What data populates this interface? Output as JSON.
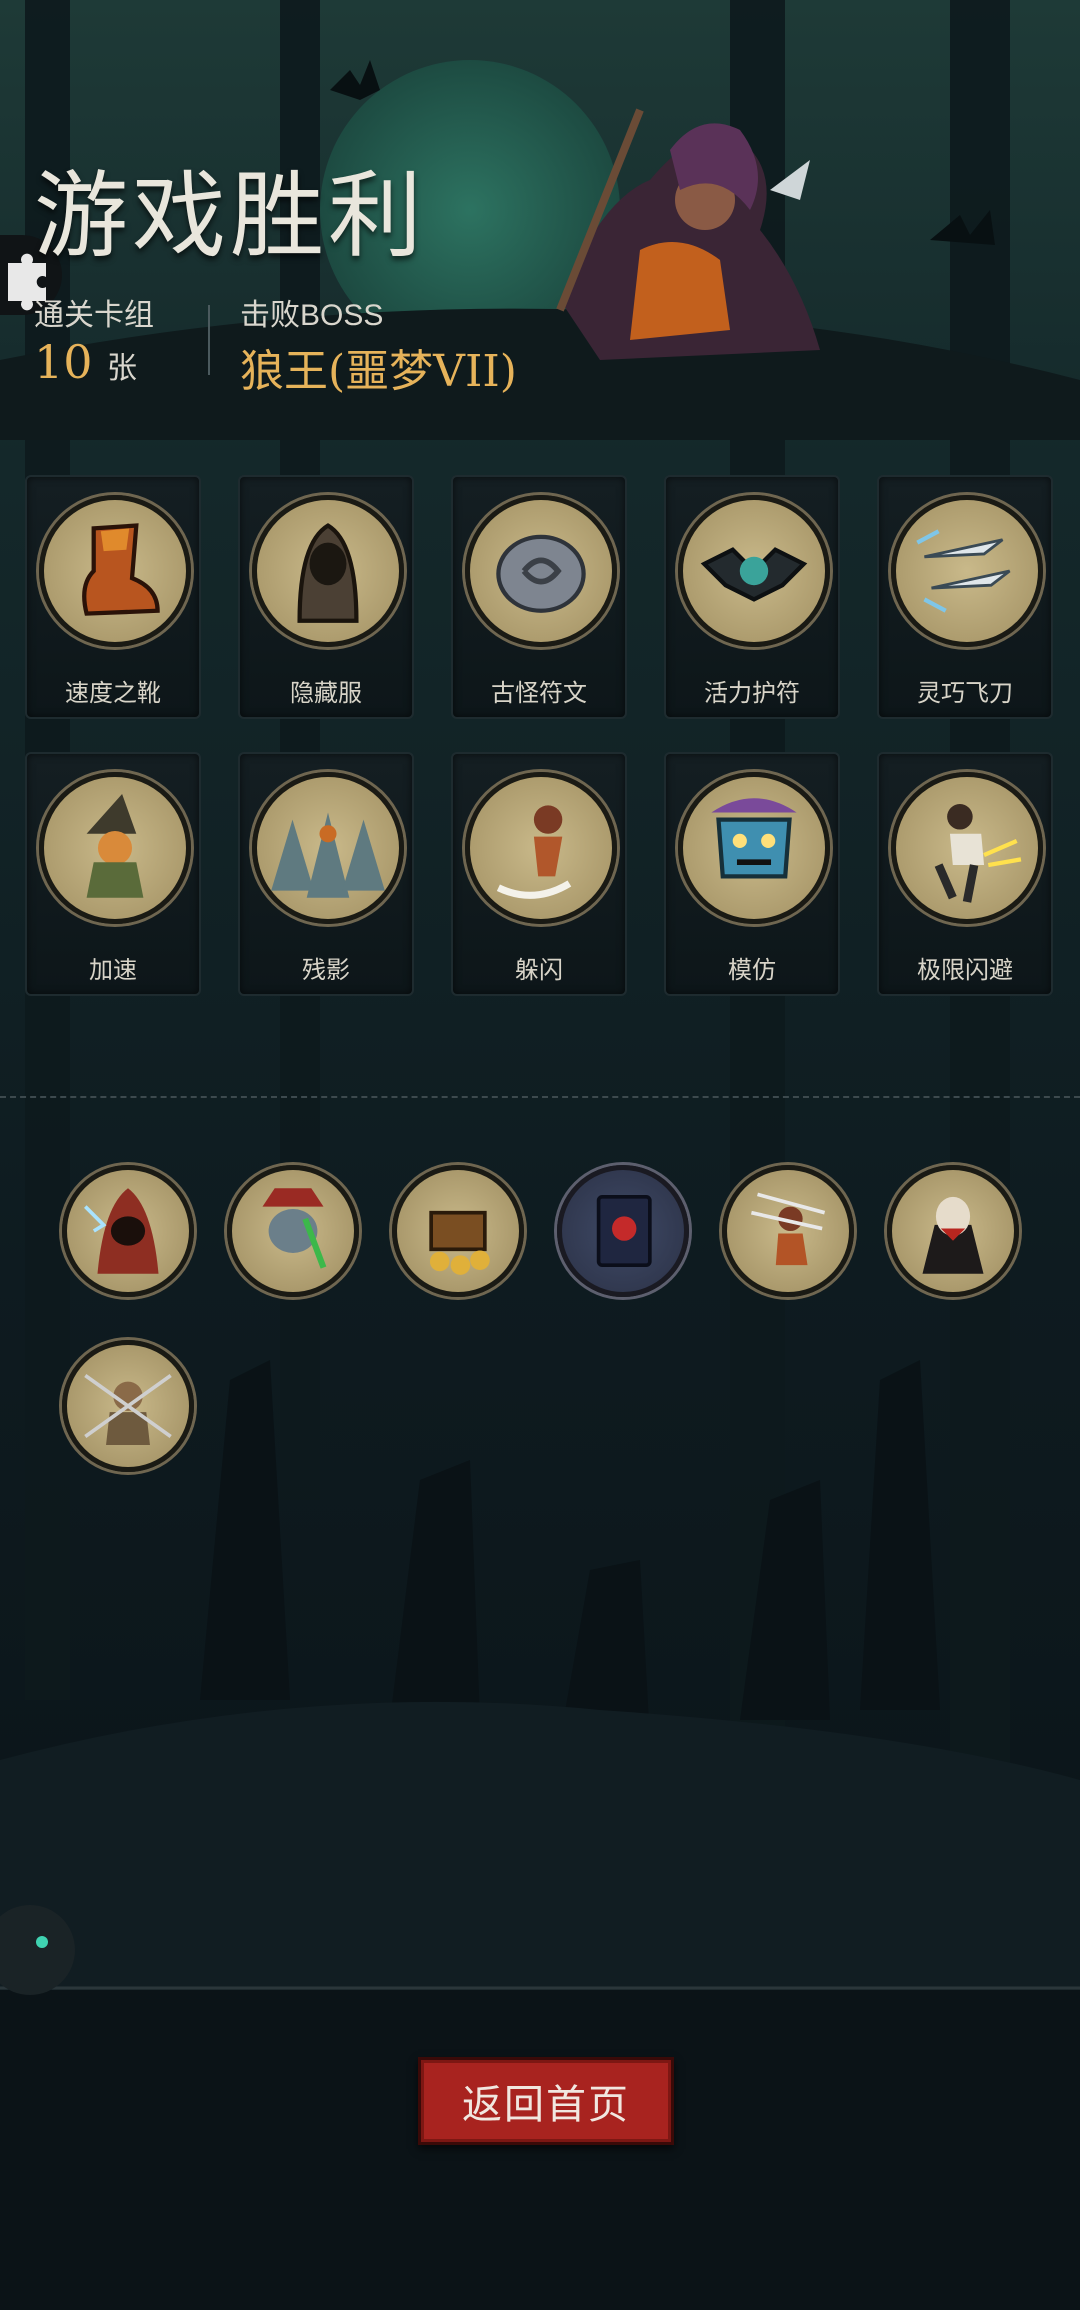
{
  "header": {
    "title": "游戏胜利",
    "deck_label": "通关卡组",
    "deck_count": "10",
    "deck_unit": "张",
    "boss_label": "击败BOSS",
    "boss_name": "狼王(噩梦VII)"
  },
  "cards": [
    {
      "name": "速度之靴",
      "icon": "boot-icon"
    },
    {
      "name": "隐藏服",
      "icon": "cloak-icon"
    },
    {
      "name": "古怪符文",
      "icon": "rune-icon"
    },
    {
      "name": "活力护符",
      "icon": "amulet-icon"
    },
    {
      "name": "灵巧飞刀",
      "icon": "knives-icon"
    },
    {
      "name": "加速",
      "icon": "witch-icon"
    },
    {
      "name": "残影",
      "icon": "afterimage-icon"
    },
    {
      "name": "躲闪",
      "icon": "dodge-icon"
    },
    {
      "name": "模仿",
      "icon": "mask-icon"
    },
    {
      "name": "极限闪避",
      "icon": "extreme-dodge-icon"
    }
  ],
  "relics": [
    {
      "icon": "hooded-mage-icon"
    },
    {
      "icon": "goblin-icon"
    },
    {
      "icon": "treasure-icon"
    },
    {
      "icon": "red-book-icon"
    },
    {
      "icon": "slash-hero-icon"
    },
    {
      "icon": "vampire-icon"
    },
    {
      "icon": "warrior-icon"
    }
  ],
  "footer": {
    "return_label": "返回首页"
  },
  "colors": {
    "accent_gold": "#e6b35a",
    "button_red": "#a8231f",
    "background": "#0c1318"
  }
}
